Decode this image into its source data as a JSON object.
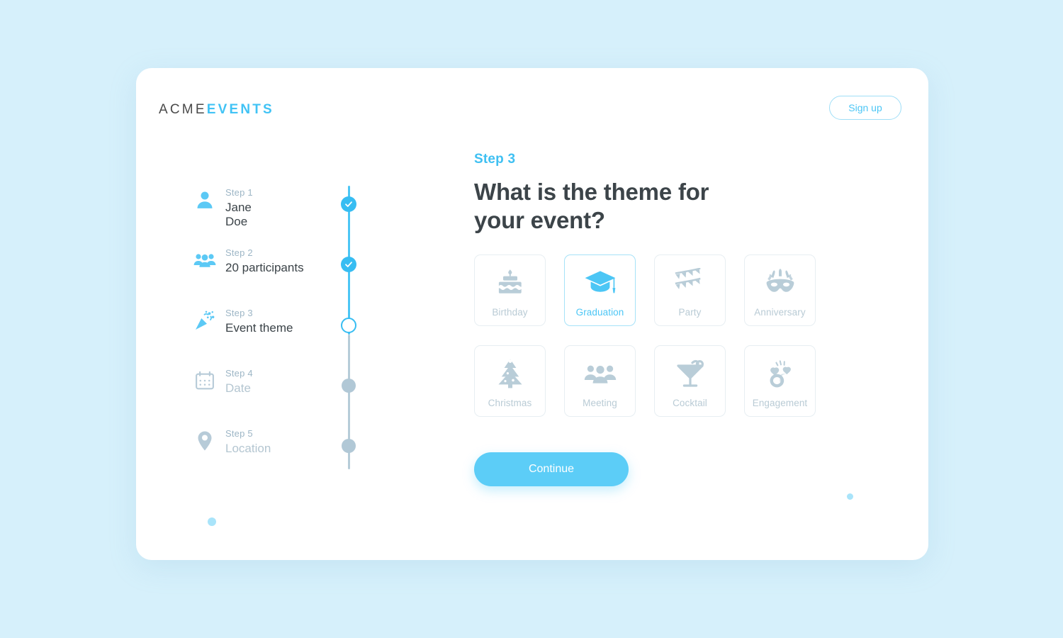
{
  "page": {
    "background_color": "#d6f0fb",
    "accent_color": "#4cc6f5",
    "muted_color": "#b4c6d1"
  },
  "header": {
    "brand_primary": "ACME",
    "brand_secondary": "EVENTS",
    "signup_label": "Sign up"
  },
  "stepper": {
    "steps": [
      {
        "number": "Step 1",
        "value": "Jane\nDoe",
        "icon": "user-icon",
        "state": "done"
      },
      {
        "number": "Step 2",
        "value": "20 participants",
        "icon": "participants-icon",
        "state": "done"
      },
      {
        "number": "Step 3",
        "value": "Event theme",
        "icon": "party-popper-icon",
        "state": "current"
      },
      {
        "number": "Step 4",
        "value": "Date",
        "icon": "calendar-icon",
        "state": "pending"
      },
      {
        "number": "Step 5",
        "value": "Location",
        "icon": "location-pin-icon",
        "state": "pending"
      }
    ]
  },
  "main": {
    "eyebrow": "Step 3",
    "headline": "What is the theme for your event?",
    "continue_label": "Continue",
    "themes": [
      {
        "label": "Birthday",
        "icon": "birthday-cake-icon",
        "selected": false
      },
      {
        "label": "Graduation",
        "icon": "graduation-cap-icon",
        "selected": true
      },
      {
        "label": "Party",
        "icon": "bunting-flags-icon",
        "selected": false
      },
      {
        "label": "Anniversary",
        "icon": "masquerade-mask-icon",
        "selected": false
      },
      {
        "label": "Christmas",
        "icon": "christmas-tree-icon",
        "selected": false
      },
      {
        "label": "Meeting",
        "icon": "people-group-icon",
        "selected": false
      },
      {
        "label": "Cocktail",
        "icon": "cocktail-glass-icon",
        "selected": false
      },
      {
        "label": "Engagement",
        "icon": "engagement-rings-icon",
        "selected": false
      }
    ]
  }
}
